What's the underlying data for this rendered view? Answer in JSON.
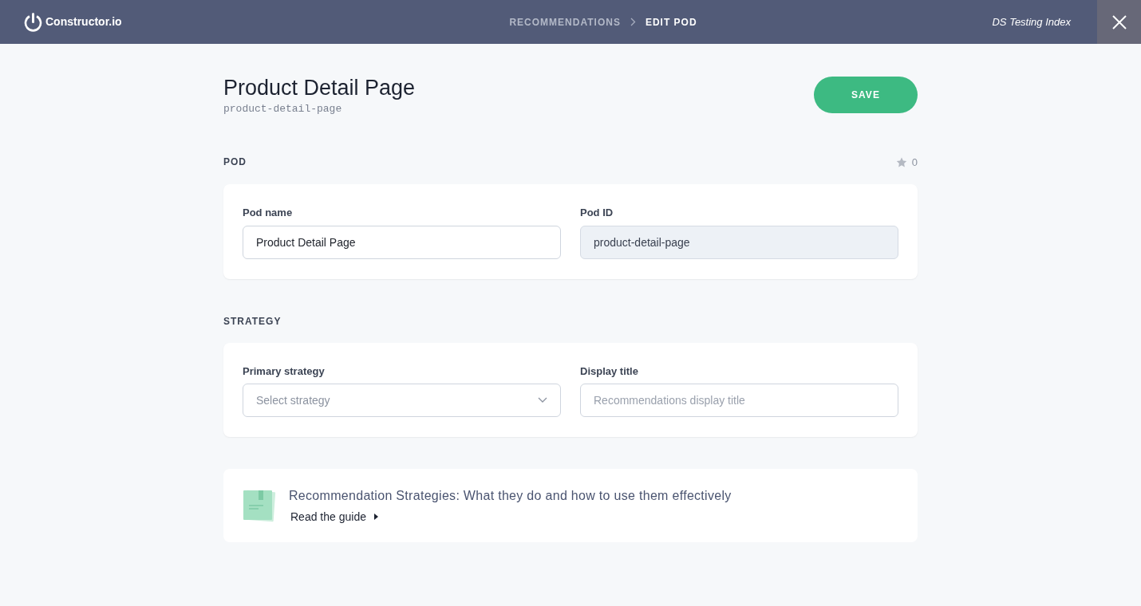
{
  "topbar": {
    "logo_text": "Constructor.io",
    "breadcrumbs": [
      {
        "label": "RECOMMENDATIONS",
        "selected": false
      },
      {
        "label": "EDIT POD",
        "selected": true
      }
    ],
    "index_name": "DS Testing Index"
  },
  "header": {
    "title": "Product Detail Page",
    "slug": "product-detail-page",
    "save_label": "SAVE"
  },
  "pod_section": {
    "heading": "POD",
    "star_count": "0",
    "fields": [
      {
        "kind": "text",
        "label": "Pod name",
        "value": "Product Detail Page",
        "disabled": false
      },
      {
        "kind": "text",
        "label": "Pod ID",
        "value": "product-detail-page",
        "disabled": true
      }
    ]
  },
  "strategy_section": {
    "heading": "STRATEGY",
    "fields": [
      {
        "kind": "select",
        "label": "Primary strategy",
        "placeholder": "Select strategy",
        "disabled": false
      },
      {
        "kind": "text",
        "label": "Display title",
        "placeholder": "Recommendations display title",
        "disabled": false
      }
    ]
  },
  "guide": {
    "title": "Recommendation Strategies: What they do and how to use them effectively",
    "link": "Read the guide"
  }
}
